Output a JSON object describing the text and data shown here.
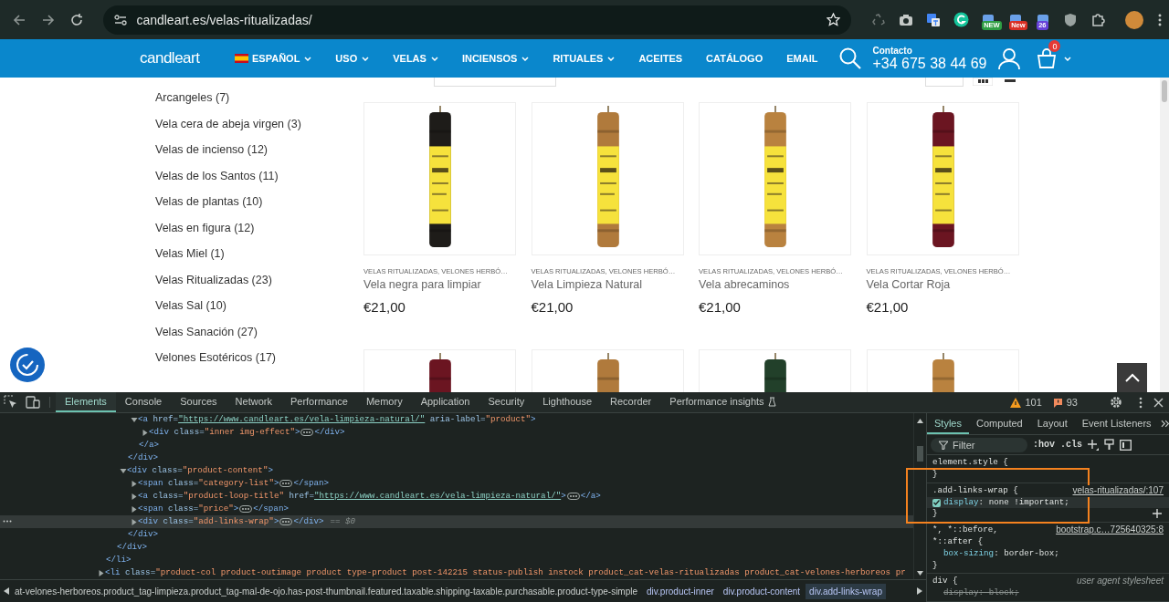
{
  "browser": {
    "url": "candleart.es/velas-ritualizadas/",
    "extensions": [
      {
        "kind": "recycle"
      },
      {
        "kind": "camera"
      },
      {
        "kind": "translate"
      },
      {
        "kind": "grammar"
      },
      {
        "kind": "badge",
        "badge": "NEW",
        "color": "#2f9e44"
      },
      {
        "kind": "badge",
        "badge": "New",
        "color": "#d93025"
      },
      {
        "kind": "badge",
        "badge": "26",
        "color": "#6741d9"
      },
      {
        "kind": "shield"
      },
      {
        "kind": "puzzle"
      }
    ]
  },
  "site": {
    "logo": "candleart",
    "language": "ESPAÑOL",
    "nav": [
      {
        "label": "USO",
        "dropdown": true
      },
      {
        "label": "VELAS",
        "dropdown": true
      },
      {
        "label": "INCIENSOS",
        "dropdown": true
      },
      {
        "label": "RITUALES",
        "dropdown": true
      },
      {
        "label": "ACEITES",
        "dropdown": false
      },
      {
        "label": "CATÁLOGO",
        "dropdown": false
      },
      {
        "label": "EMAIL",
        "dropdown": false
      }
    ],
    "contact_label": "Contacto",
    "phone": "+34 675 38 44 69",
    "cart_count": "0"
  },
  "categories": [
    "Arcangeles (7)",
    "Vela cera de abeja virgen (3)",
    "Velas de incienso (12)",
    "Velas de los Santos (11)",
    "Velas de plantas (10)",
    "Velas en figura (12)",
    "Velas Miel (1)",
    "Velas Ritualizadas (23)",
    "Velas Sal (10)",
    "Velas Sanación (27)",
    "Velones Esotéricos (17)"
  ],
  "products": [
    {
      "kind": "picture",
      "categories": "VELAS RITUALIZADAS, VELONES HERBÓ…",
      "name": "Vela negra para limpiar",
      "price": "€21,00"
    },
    {
      "kind": "picture",
      "categories": "VELAS RITUALIZADAS, VELONES HERBÓ…",
      "name": "Vela Limpieza Natural",
      "price": "€21,00"
    },
    {
      "kind": "picture",
      "categories": "VELAS RITUALIZADAS, VELONES HERBÓ…",
      "name": "Vela abrecaminos",
      "price": "€21,00"
    },
    {
      "kind": "picture",
      "categories": "VELAS RITUALIZADAS, VELONES HERBÓ…",
      "name": "Vela Cortar Roja",
      "price": "€21,00"
    }
  ],
  "devtools": {
    "tabs": [
      {
        "label": "Elements",
        "selected": true
      },
      {
        "label": "Console",
        "selected": false
      },
      {
        "label": "Sources",
        "selected": false
      },
      {
        "label": "Network",
        "selected": false
      },
      {
        "label": "Performance",
        "selected": false
      },
      {
        "label": "Memory",
        "selected": false
      },
      {
        "label": "Application",
        "selected": false
      },
      {
        "label": "Security",
        "selected": false
      },
      {
        "label": "Lighthouse",
        "selected": false
      },
      {
        "label": "Recorder",
        "selected": false
      },
      {
        "label": "Performance insights",
        "selected": false,
        "beta": true
      }
    ],
    "warnings": "101",
    "errors": "93",
    "dom_tree": [
      {
        "close_tag": "</li>",
        "children": [
          {
            "close_tag": "</div>",
            "children": [
              {
                "close_tag": "</div>",
                "children": [
                  {
                    "open_tag": "<a href=\"https://www.candleart.es/vela-limpieza-natural/\" aria-label=\"product\">",
                    "close_tag": "</a>",
                    "expanded": true,
                    "selected": false,
                    "children": [
                      {
                        "open_tag": "<div class=\"inner img-effect\">",
                        "close_tag": "</div>",
                        "expanded": false,
                        "selected": false
                      }
                    ]
                  }
                ]
              },
              {
                "open_tag": "<div class=\"product-content\">",
                "close_tag": "</div>",
                "expanded": true,
                "selected": false,
                "children": [
                  {
                    "open_tag": "<span class=\"category-list\">",
                    "close_tag": "</span>",
                    "expanded": false,
                    "selected": false
                  },
                  {
                    "open_tag": "<a class=\"product-loop-title\" href=\"https://www.candleart.es/vela-limpieza-natural/\">",
                    "close_tag": "</a>",
                    "expanded": false,
                    "selected": false
                  },
                  {
                    "open_tag": "<span class=\"price\">",
                    "close_tag": "</span>",
                    "expanded": false,
                    "selected": false
                  },
                  {
                    "open_tag": "<div class=\"add-links-wrap\">",
                    "close_tag": "</div>",
                    "expanded": false,
                    "selected": true,
                    "suffix": "== $0"
                  }
                ]
              }
            ]
          }
        ]
      },
      {
        "open_tag": "<li class=\"product-col product-outimage product type-product post-142215 status-publish instock product_cat-velas-ritualizadas product_cat-velones-herboreos pr",
        "expanded": false,
        "selected": false
      }
    ],
    "breadcrumbs": [
      {
        "label": "at-velones-herboreos.product_tag-limpieza.product_tag-mal-de-ojo.has-post-thumbnail.featured.taxable.shipping-taxable.purchasable.product-type-simple",
        "selected": false
      },
      {
        "label": "div.product-inner",
        "selected": false
      },
      {
        "label": "div.product-content",
        "selected": false
      },
      {
        "label": "div.add-links-wrap",
        "selected": true
      }
    ],
    "styles": {
      "tabs": [
        {
          "label": "Styles",
          "selected": true
        },
        {
          "label": "Computed",
          "selected": false
        },
        {
          "label": "Layout",
          "selected": false
        },
        {
          "label": "Event Listeners",
          "selected": false
        }
      ],
      "filter_placeholder": "Filter",
      "toggles": [
        ":hov",
        ".cls"
      ],
      "rules": [
        {
          "selector_lines": [
            "element.style {"
          ],
          "close": "}",
          "active": false
        },
        {
          "selector_lines": [
            ".add-links-wrap {"
          ],
          "source": "velas-ritualizadas/:107",
          "user_agent": false,
          "active": true,
          "close": "}",
          "properties": [
            {
              "text": "display: none !important;",
              "checked": true,
              "overridden": false
            }
          ]
        },
        {
          "selector_lines": [
            "*, *::before,",
            "*::after {"
          ],
          "source": "bootstrap.c…725640325:8",
          "user_agent": false,
          "active": false,
          "close": "}",
          "properties": [
            {
              "text": "box-sizing: border-box;",
              "overridden": false
            }
          ]
        },
        {
          "selector_lines": [
            "div {"
          ],
          "source": "user agent stylesheet",
          "user_agent": true,
          "active": false,
          "properties": [
            {
              "text": "display: block;",
              "overridden": true
            }
          ]
        }
      ]
    },
    "highlight_frame": {
      "kind": "rectangle"
    }
  }
}
